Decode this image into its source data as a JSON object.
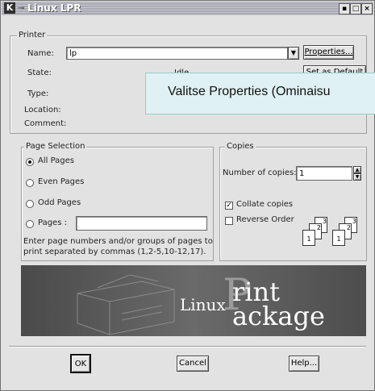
{
  "window": {
    "title": "Linux LPR",
    "logo": "K",
    "controls": [
      "▪",
      "□",
      "×"
    ]
  },
  "printer": {
    "legend": "Printer",
    "name_label": "Name:",
    "name_value": "lp",
    "properties_button": "Properties...",
    "state_label": "State:",
    "state_value": "Idle",
    "setdefault_button": "Set as Default",
    "type_label": "Type:",
    "location_label": "Location:",
    "comment_label": "Comment:"
  },
  "tooltip": {
    "text": "Valitse Properties (Ominaisu"
  },
  "page_selection": {
    "legend": "Page Selection",
    "options": [
      "All Pages",
      "Even Pages",
      "Odd Pages",
      "Pages :"
    ],
    "selected": "All Pages",
    "pages_value": "",
    "hint": "Enter page numbers and/or groups of pages to print separated by commas (1,2-5,10-12,17).",
    "hint_line1": "Enter page numbers and/or groups of pages to",
    "hint_line2": "print separated by commas (1,2-5,10-12,17)."
  },
  "copies": {
    "legend": "Copies",
    "number_label": "Number of copies:",
    "number_value": "1",
    "collate_label": "Collate copies",
    "collate_checked": true,
    "reverse_label": "Reverse Order",
    "reverse_checked": false,
    "page_numbers": [
      "3",
      "2",
      "1",
      "3",
      "2",
      "1"
    ]
  },
  "banner": {
    "linux": "Linux",
    "print": "rint",
    "package": "ackage",
    "big_letter": "P"
  },
  "buttons": {
    "ok": "OK",
    "cancel": "Cancel",
    "help": "Help..."
  },
  "icons": {
    "dropdown": "chevron-down-icon",
    "spin": "spin-icon",
    "printer": "printer-icon"
  }
}
